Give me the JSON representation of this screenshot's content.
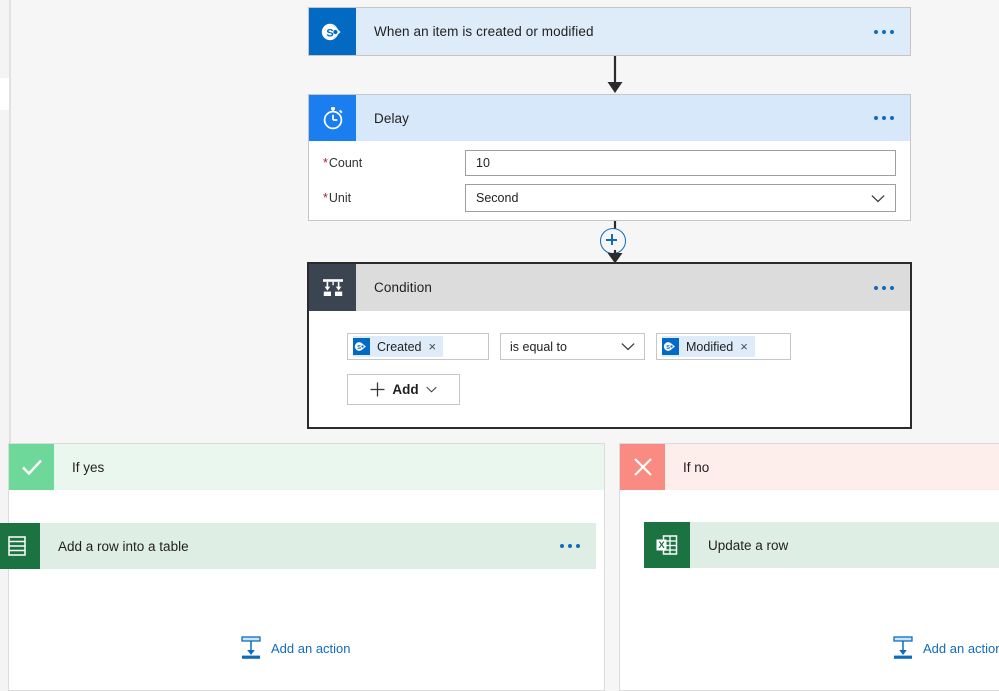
{
  "app": {
    "name": "Power Automate flow designer canvas"
  },
  "trigger": {
    "title": "When an item is created or modified",
    "icon": "sharepoint-icon",
    "menu_label": "More commands",
    "header_color": "#deecf9",
    "icon_color": "#036ac4"
  },
  "delay": {
    "title": "Delay",
    "icon": "stopwatch-icon",
    "menu_label": "More commands",
    "header_color": "#d6e8f9",
    "icon_color": "#1a7ef0",
    "fields": [
      {
        "label": "Count",
        "required": true,
        "value": "10",
        "type": "text"
      },
      {
        "label": "Unit",
        "required": true,
        "value": "Second",
        "type": "select"
      }
    ]
  },
  "insert_button": {
    "label": "+",
    "tooltip": "Insert a new step",
    "color": "#0f6cbd"
  },
  "condition": {
    "title": "Condition",
    "icon": "condition-icon",
    "menu_label": "More commands",
    "header_color": "#dcdcdc",
    "icon_color": "#3b4552",
    "row": {
      "left_token": {
        "text": "Created",
        "icon": "sharepoint-icon",
        "remove": "×"
      },
      "operator": "is equal to",
      "right_token": {
        "text": "Modified",
        "icon": "sharepoint-icon",
        "remove": "×"
      }
    },
    "add_button": {
      "label": "Add",
      "plus": "+"
    }
  },
  "branches": [
    {
      "key": "yes",
      "label": "If yes",
      "icon": "check-icon",
      "accent_color": "#6ed89a",
      "header_color": "#eaf7ee",
      "action": {
        "title": "Add a row into a table",
        "icon": "excel-icon",
        "icon_color": "#1a7340",
        "card_color": "#dfeee4",
        "menu_label": "More commands"
      },
      "add_action": {
        "label": "Add an action",
        "icon": "insert-action-icon"
      }
    },
    {
      "key": "no",
      "label": "If no",
      "icon": "close-icon",
      "accent_color": "#f98b83",
      "header_color": "#fdeeec",
      "action": {
        "title": "Update a row",
        "icon": "excel-icon",
        "icon_color": "#1a7340",
        "card_color": "#dfeee4",
        "menu_label": "More commands"
      },
      "add_action": {
        "label": "Add an action",
        "icon": "insert-action-icon"
      }
    }
  ]
}
